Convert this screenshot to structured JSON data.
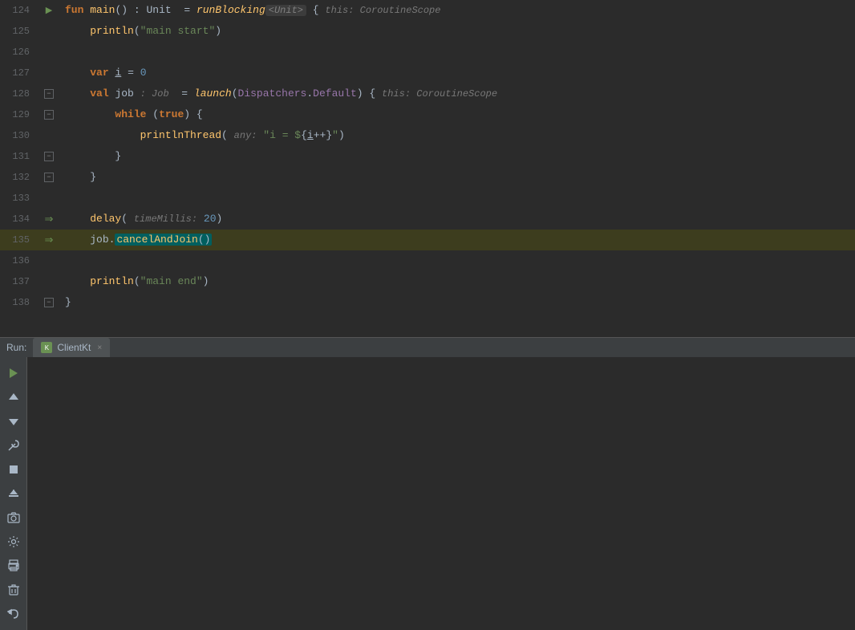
{
  "editor": {
    "lines": [
      {
        "num": "124",
        "gutter": "arrow",
        "content": "fun_main_line",
        "highlighted": false
      },
      {
        "num": "125",
        "gutter": "",
        "content": "println_main_start",
        "highlighted": false
      },
      {
        "num": "126",
        "gutter": "",
        "content": "empty",
        "highlighted": false
      },
      {
        "num": "127",
        "gutter": "",
        "content": "var_i",
        "highlighted": false
      },
      {
        "num": "128",
        "gutter": "fold",
        "content": "val_job",
        "highlighted": false
      },
      {
        "num": "129",
        "gutter": "fold",
        "content": "while_true",
        "highlighted": false
      },
      {
        "num": "130",
        "gutter": "",
        "content": "printlnThread",
        "highlighted": false
      },
      {
        "num": "131",
        "gutter": "fold",
        "content": "close_brace_1",
        "highlighted": false
      },
      {
        "num": "132",
        "gutter": "fold",
        "content": "close_brace_2",
        "highlighted": false
      },
      {
        "num": "133",
        "gutter": "",
        "content": "empty",
        "highlighted": false
      },
      {
        "num": "134",
        "gutter": "double_arrow",
        "content": "delay_line",
        "highlighted": false
      },
      {
        "num": "135",
        "gutter": "double_arrow",
        "content": "cancel_join",
        "highlighted": true
      },
      {
        "num": "136",
        "gutter": "",
        "content": "empty",
        "highlighted": false
      },
      {
        "num": "137",
        "gutter": "",
        "content": "println_main_end",
        "highlighted": false
      },
      {
        "num": "138",
        "gutter": "fold",
        "content": "close_brace_3",
        "highlighted": false
      }
    ]
  },
  "run_panel": {
    "label": "Run:",
    "tab_name": "ClientKt",
    "close_symbol": "×"
  },
  "toolbar": {
    "buttons": [
      "▶",
      "↑",
      "↓",
      "🔧",
      "⊟",
      "↧",
      "📷",
      "⚙",
      "🖨",
      "🗑",
      "↩"
    ]
  }
}
